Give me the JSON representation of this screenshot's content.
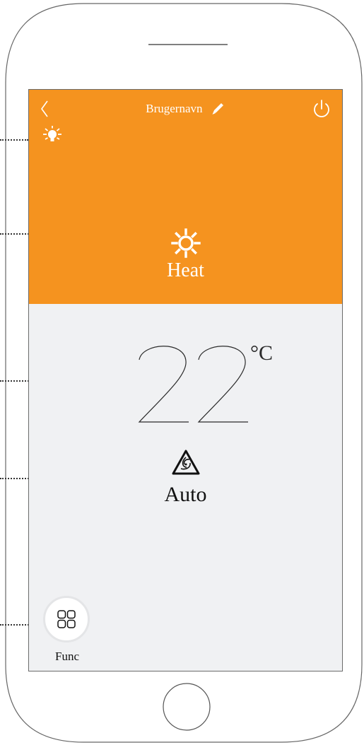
{
  "header": {
    "title": "Brugernavn",
    "background_color": "#f5931f"
  },
  "mode": {
    "label": "Heat",
    "icon": "sun-icon"
  },
  "temperature": {
    "value": "22",
    "unit": "°C"
  },
  "fan": {
    "label": "Auto",
    "icon": "fan-icon"
  },
  "func": {
    "label": "Func",
    "icon": "grid-icon"
  }
}
